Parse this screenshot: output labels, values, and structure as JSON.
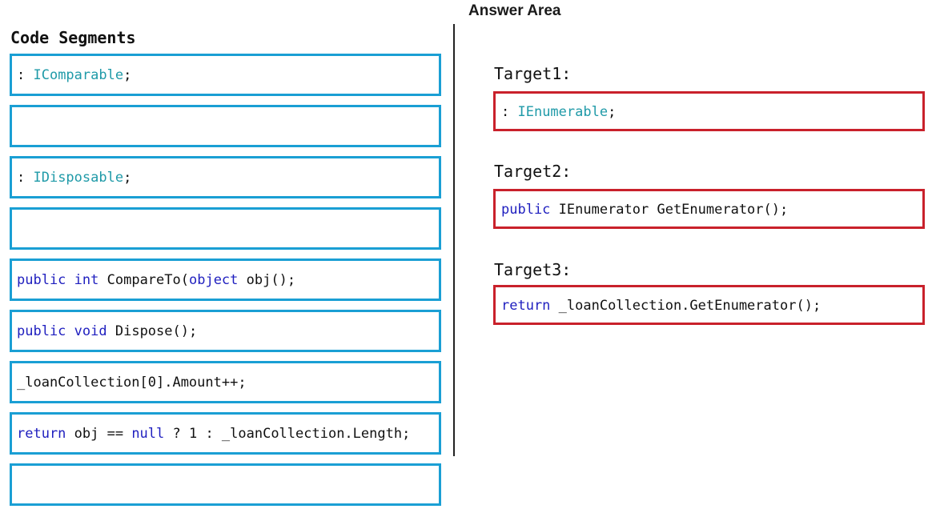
{
  "answer_area": {
    "title": "Answer Area"
  },
  "code_segments": {
    "title": "Code Segments",
    "items": [
      {
        "parts": [
          {
            "t": ": ",
            "c": "plain"
          },
          {
            "t": "IComparable",
            "c": "type"
          },
          {
            "t": ";",
            "c": "plain"
          }
        ]
      },
      {
        "parts": []
      },
      {
        "parts": [
          {
            "t": ": ",
            "c": "plain"
          },
          {
            "t": "IDisposable",
            "c": "type"
          },
          {
            "t": ";",
            "c": "plain"
          }
        ]
      },
      {
        "parts": []
      },
      {
        "parts": [
          {
            "t": "public",
            "c": "kw"
          },
          {
            "t": " ",
            "c": "plain"
          },
          {
            "t": "int",
            "c": "kw"
          },
          {
            "t": " CompareTo(",
            "c": "plain"
          },
          {
            "t": "object",
            "c": "kw"
          },
          {
            "t": " obj();",
            "c": "plain"
          }
        ]
      },
      {
        "parts": [
          {
            "t": "public",
            "c": "kw"
          },
          {
            "t": " ",
            "c": "plain"
          },
          {
            "t": "void",
            "c": "kw"
          },
          {
            "t": " Dispose();",
            "c": "plain"
          }
        ]
      },
      {
        "parts": [
          {
            "t": "_loanCollection[0].Amount++;",
            "c": "plain"
          }
        ]
      },
      {
        "parts": [
          {
            "t": "return",
            "c": "kw"
          },
          {
            "t": " obj == ",
            "c": "plain"
          },
          {
            "t": "null",
            "c": "kw"
          },
          {
            "t": " ? 1 : _loanCollection.Length;",
            "c": "plain"
          }
        ]
      },
      {
        "parts": []
      }
    ]
  },
  "targets": [
    {
      "label": "Target1:",
      "parts": [
        {
          "t": ": ",
          "c": "plain"
        },
        {
          "t": "IEnumerable",
          "c": "type"
        },
        {
          "t": ";",
          "c": "plain"
        }
      ]
    },
    {
      "label": "Target2:",
      "parts": [
        {
          "t": "public",
          "c": "kw"
        },
        {
          "t": " IEnumerator GetEnumerator();",
          "c": "plain"
        }
      ]
    },
    {
      "label": "Target3:",
      "parts": [
        {
          "t": "return",
          "c": "kw"
        },
        {
          "t": " _loanCollection.GetEnumerator();",
          "c": "plain"
        }
      ]
    }
  ],
  "colors": {
    "segment_border": "#1a9fd4",
    "target_border": "#c9212b",
    "keyword": "#1f1fbf",
    "type": "#1f9aa8"
  }
}
